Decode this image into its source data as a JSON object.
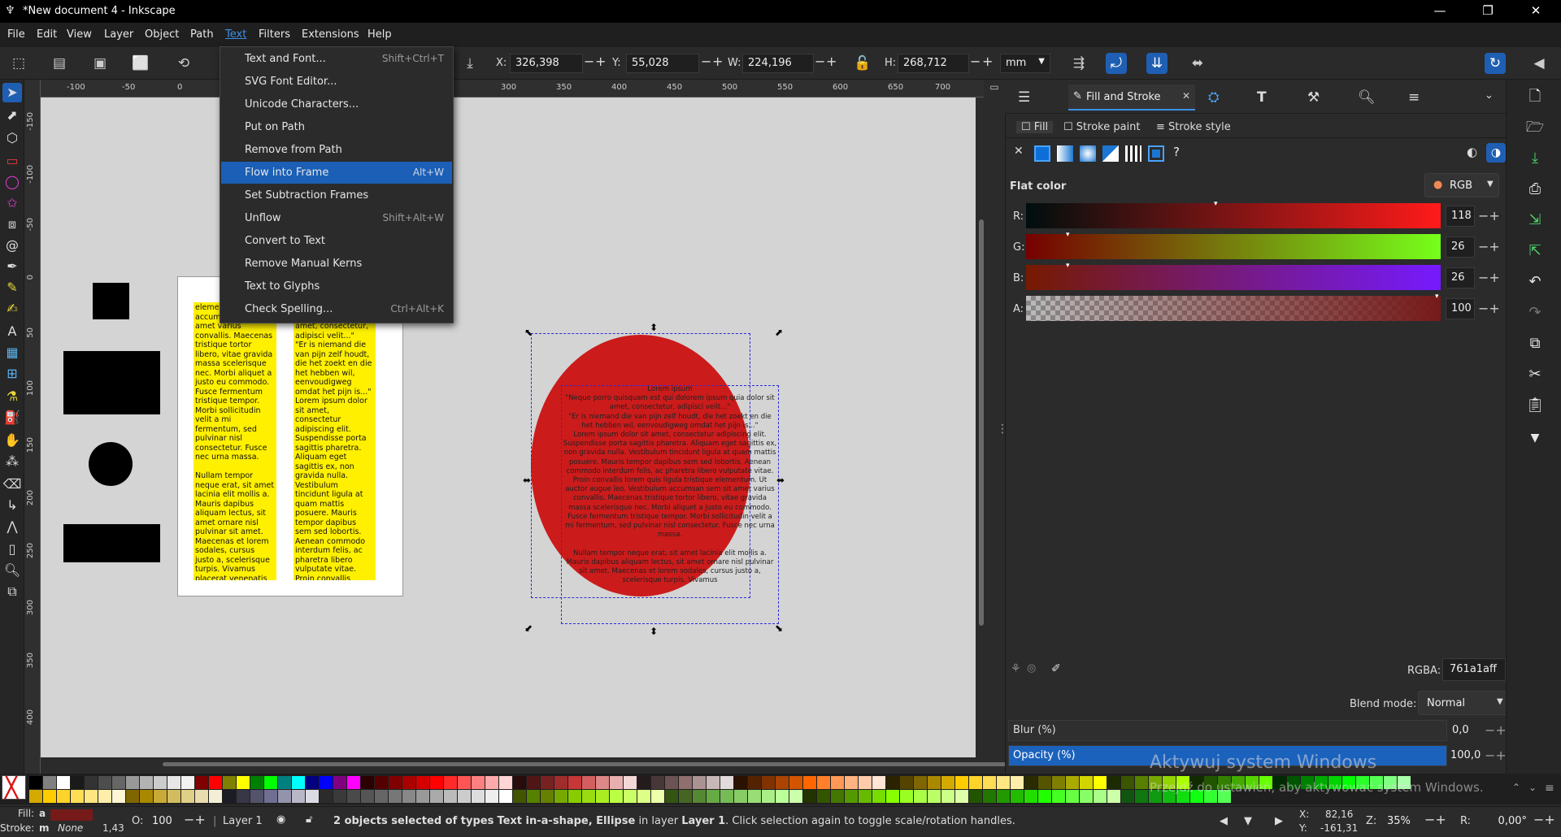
{
  "window": {
    "title": "*New document 4 - Inkscape",
    "controls": {
      "minimize": "—",
      "maximize": "❐",
      "close": "✕"
    }
  },
  "menubar": [
    "File",
    "Edit",
    "View",
    "Layer",
    "Object",
    "Path",
    "Text",
    "Filters",
    "Extensions",
    "Help"
  ],
  "active_menu": "Text",
  "toolbar": {
    "x_label": "X:",
    "x_value": "326,398",
    "y_label": "Y:",
    "y_value": "55,028",
    "w_label": "W:",
    "w_value": "224,196",
    "h_label": "H:",
    "h_value": "268,712",
    "unit": "mm",
    "minus": "−",
    "plus": "+"
  },
  "text_menu": [
    {
      "label": "Text and Font...",
      "shortcut": "Shift+Ctrl+T"
    },
    {
      "label": "SVG Font Editor...",
      "shortcut": ""
    },
    {
      "label": "Unicode Characters...",
      "shortcut": ""
    },
    {
      "label": "Put on Path",
      "shortcut": ""
    },
    {
      "label": "Remove from Path",
      "shortcut": ""
    },
    {
      "label": "Flow into Frame",
      "shortcut": "Alt+W",
      "highlighted": true
    },
    {
      "label": "Set Subtraction Frames",
      "shortcut": ""
    },
    {
      "label": "Unflow",
      "shortcut": "Shift+Alt+W"
    },
    {
      "label": "Convert to Text",
      "shortcut": ""
    },
    {
      "label": "Remove Manual Kerns",
      "shortcut": ""
    },
    {
      "label": "Text to Glyphs",
      "shortcut": ""
    },
    {
      "label": "Check Spelling...",
      "shortcut": "Ctrl+Alt+K"
    }
  ],
  "ruler_top": [
    "-100",
    "-50",
    "0",
    "300",
    "350",
    "400",
    "450",
    "500",
    "550",
    "600",
    "650",
    "700"
  ],
  "ruler_left": [
    "-150",
    "-100",
    "-50",
    "0",
    "50",
    "100",
    "150",
    "200",
    "250",
    "300",
    "350",
    "400"
  ],
  "canvas": {
    "column1_text": "element augue accumsan sem sit amet varius convallis. Maecenas tristique tortor libero, vitae gravida massa scelerisque nec. Morbi aliquet a justo eu commodo. Fusce fermentum tristique tempor. Morbi sollicitudin velit a mi fermentum, sed pulvinar nisl consectetur. Fusce nec urna massa.\n\nNullam tempor neque erat, sit amet lacinia elit mollis a. Mauris dapibus aliquam lectus, sit amet ornare nisl pulvinar sit amet. Maecenas et lorem sodales, cursus justo a, scelerisque turpis. Vivamus placerat venenatis ultrices.",
    "column2_text": "est qui dolorem ipsum quia dolor sit amet, consectetur, adipisci velit...\"\n\"Er is niemand die van pijn zelf houdt, die het zoekt en die het hebben wil, eenvoudigweg omdat het pijn is...\"\nLorem ipsum dolor sit amet, consectetur adipiscing elit. Suspendisse porta sagittis pharetra. Aliquam eget sagittis ex, non gravida nulla. Vestibulum tincidunt ligula at quam mattis posuere. Mauris tempor dapibus sem sed lobortis. Aenean commodo interdum felis, ac pharetra libero vulputate vitae. Proin convallis lorem quis ligula tristique",
    "flow_text": "Lorem ipsum\n\"Neque porro quisquam est qui dolorem ipsum quia dolor sit amet, consectetur, adipisci velit...\"\n\"Er is niemand die van pijn zelf houdt, die het zoekt en die het hebben wil, eenvoudigweg omdat het pijn is...\"\nLorem ipsum dolor sit amet, consectetur adipiscing elit. Suspendisse porta sagittis pharetra. Aliquam eget sagittis ex, non gravida nulla. Vestibulum tincidunt ligula at quam mattis posuere. Mauris tempor dapibus sem sed lobortis. Aenean commodo interdum felis, ac pharetra libero vulputate vitae. Proin convallis lorem quis ligula tristique elementum. Ut auctor augue leo. Vestibulum accumsan sem sit amet varius convallis. Maecenas tristique tortor libero, vitae gravida massa scelerisque nec. Morbi aliquet a justo eu commodo. Fusce fermentum tristique tempor. Morbi sollicitudin velit a mi fermentum, sed pulvinar nisl consectetur. Fusce nec urna massa.\n\nNullam tempor neque erat, sit amet lacinia elit mollis a. Mauris dapibus aliquam lectus, sit amet ornare nisl pulvinar sit amet. Maecenas et lorem sodales, cursus justo a, scelerisque turpis. Vivamus",
    "ellipse_color": "#cc1b1b",
    "column_color": "#fff000"
  },
  "dock": {
    "active_tab": "Fill and Stroke",
    "subtabs": {
      "fill": "Fill",
      "stroke_paint": "Stroke paint",
      "stroke_style": "Stroke style"
    },
    "paint_heading": "Flat color",
    "mode": "RGB",
    "channels": [
      {
        "label": "R:",
        "value": "118",
        "fraction": 0.463
      },
      {
        "label": "G:",
        "value": "26",
        "fraction": 0.102
      },
      {
        "label": "B:",
        "value": "26",
        "fraction": 0.102
      },
      {
        "label": "A:",
        "value": "100",
        "fraction": 1.0
      }
    ],
    "rgba_label": "RGBA:",
    "rgba_value": "761a1aff",
    "blend_label": "Blend mode:",
    "blend_value": "Normal",
    "blur_label": "Blur (%)",
    "blur_value": "0,0",
    "opacity_label": "Opacity (%)",
    "opacity_value": "100,0",
    "help_glyph": "?"
  },
  "statusbar": {
    "fill_label": "Fill:",
    "fill_value": "a",
    "stroke_label": "Stroke:",
    "stroke_value": "m",
    "stroke_none": "None",
    "stroke_width": "1,43",
    "opacity_label": "O:",
    "opacity_value": "100",
    "layer": "Layer 1",
    "message_prefix": "2 objects selected of types",
    "message_types": "Text in-a-shape, Ellipse",
    "message_mid": "in layer",
    "message_layer": "Layer 1",
    "message_suffix": ". Click selection again to toggle scale/rotation handles.",
    "x_label": "X:",
    "x_value": "82,16",
    "y_label": "Y:",
    "y_value": "-161,31",
    "zoom_label": "Z:",
    "zoom_value": "35%",
    "rotate_label": "R:",
    "rotate_value": "0,00°"
  },
  "watermark": {
    "line1": "Aktywuj system Windows",
    "line2": "Przejdź do ustawień, aby aktywować system Windows."
  },
  "palette_colors": [
    "#000000",
    "#808080",
    "#ffffff",
    "#1a1a1a",
    "#333333",
    "#4d4d4d",
    "#666666",
    "#999999",
    "#b3b3b3",
    "#cccccc",
    "#e6e6e6",
    "#f2f2f2",
    "#800000",
    "#ff0000",
    "#808000",
    "#ffff00",
    "#008000",
    "#00ff00",
    "#008080",
    "#00ffff",
    "#000080",
    "#0000ff",
    "#800080",
    "#ff00ff",
    "#2b0000",
    "#550000",
    "#800000",
    "#aa0000",
    "#d40000",
    "#ff0000",
    "#ff2a2a",
    "#ff5555",
    "#ff8080",
    "#ffaaaa",
    "#ffd5d5",
    "#280b0b",
    "#501616",
    "#782121",
    "#a02c2c",
    "#c83737",
    "#d35f5f",
    "#de8787",
    "#e9afaf",
    "#f4d7d7",
    "#241c1c",
    "#483737",
    "#6c5353",
    "#916f6f",
    "#ac9393",
    "#c8b7b7",
    "#e3dbdb",
    "#2b1100",
    "#552200",
    "#803300",
    "#aa4400",
    "#d45500",
    "#ff6600",
    "#ff7f2a",
    "#ff9955",
    "#ffb380",
    "#ffccaa",
    "#ffe6d5",
    "#2b2200",
    "#554400",
    "#806600",
    "#aa8800",
    "#d4aa00",
    "#ffcc00",
    "#ffd42a",
    "#ffdd55",
    "#ffe680",
    "#ffeeaa",
    "#2b2b00",
    "#555500",
    "#808000",
    "#aaaa00",
    "#d4d400",
    "#ffff00",
    "#1d2b00",
    "#3b5500",
    "#588000",
    "#77aa00",
    "#94d400",
    "#aaff00",
    "#112b00",
    "#225500",
    "#338000",
    "#44aa00",
    "#55d400",
    "#66ff00",
    "#002b00",
    "#005500",
    "#008000",
    "#00aa00",
    "#00d400",
    "#00ff00",
    "#2aff2a",
    "#55ff55",
    "#80ff80",
    "#aaffaa"
  ],
  "palette_row2": [
    "#d4aa00",
    "#ffcc00",
    "#ffd42a",
    "#ffdd55",
    "#ffe680",
    "#ffeeaa",
    "#fff6d5",
    "#806600",
    "#aa8800",
    "#c8ab37",
    "#d3bc5f",
    "#dfd087",
    "#e9ddaf",
    "#f4eed7",
    "#1c1c24",
    "#373748",
    "#53536c",
    "#6f6f91",
    "#9393ac",
    "#b7b7c8",
    "#dbdbe3",
    "#2b2b2b",
    "#3a3a3a",
    "#4a4a4a",
    "#555555",
    "#666666",
    "#777777",
    "#888888",
    "#999999",
    "#aaaaaa",
    "#bbbbbb",
    "#cccccc",
    "#dddddd",
    "#eeeeee",
    "#ffffff",
    "#445500",
    "#558000",
    "#668000",
    "#77aa00",
    "#88cc00",
    "#99dd11",
    "#aaee22",
    "#bbff44",
    "#ccff66",
    "#ddff88",
    "#eeffaa",
    "#335511",
    "#446622",
    "#558833",
    "#66aa44",
    "#77bb55",
    "#88cc66",
    "#99dd77",
    "#aaee88",
    "#bbff99",
    "#ccffaa",
    "#223300",
    "#335500",
    "#447700",
    "#559900",
    "#66bb00",
    "#77dd00",
    "#88ff00",
    "#99ff22",
    "#aaff44",
    "#bbff66",
    "#ccff88",
    "#ddffaa",
    "#225500",
    "#227700",
    "#229900",
    "#22bb00",
    "#22dd00",
    "#22ff00",
    "#44ff22",
    "#66ff44",
    "#88ff66",
    "#aaff88",
    "#ccffaa",
    "#115511",
    "#117711",
    "#119911",
    "#11bb11",
    "#11dd11",
    "#11ff11",
    "#33ff33",
    "#55ff55"
  ]
}
